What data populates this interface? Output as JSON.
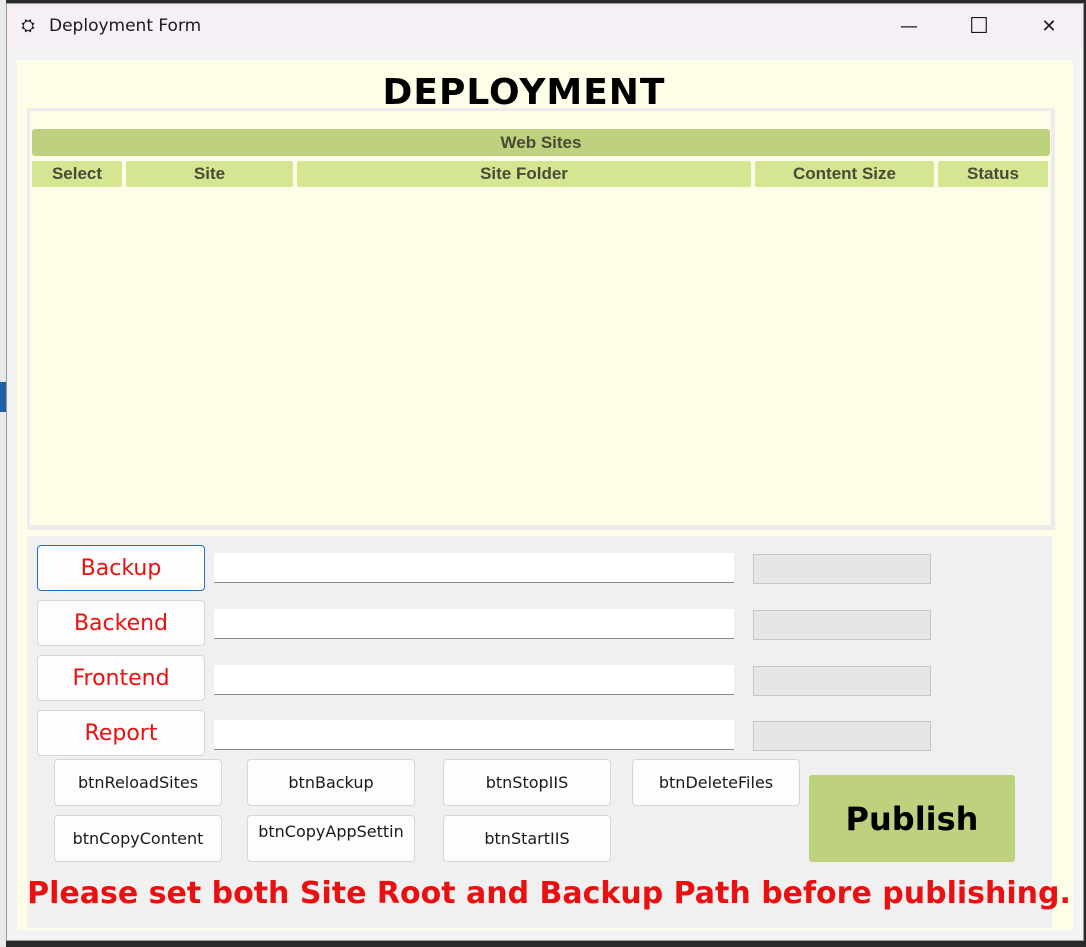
{
  "window": {
    "title": "Deployment Form",
    "app_icon": "⛭",
    "minimize_glyph": "—",
    "maximize_glyph": "☐",
    "close_glyph": "✕"
  },
  "heading": "DEPLOYMENT",
  "grid": {
    "title": "Web Sites",
    "columns": [
      "Select",
      "Site",
      "Site Folder",
      "Content Size",
      "Status"
    ],
    "rows": []
  },
  "path_rows": [
    {
      "button": "Backup",
      "value": ""
    },
    {
      "button": "Backend",
      "value": ""
    },
    {
      "button": "Frontend",
      "value": ""
    },
    {
      "button": "Report",
      "value": ""
    }
  ],
  "action_buttons": {
    "reload_sites": "btnReloadSites",
    "backup": "btnBackup",
    "stop_iis": "btnStopIIS",
    "delete_files": "btnDeleteFiles",
    "copy_content": "btnCopyContent",
    "copy_app_settings": "btnCopyAppSettin",
    "start_iis": "btnStartIIS"
  },
  "publish_label": "Publish",
  "message": "Please set both Site Root and Backup Path before publishing.",
  "colors": {
    "accent_green": "#bdd17f",
    "header_green": "#d5e692",
    "panel_bg": "#fefee8",
    "warning_red": "#e81010"
  }
}
